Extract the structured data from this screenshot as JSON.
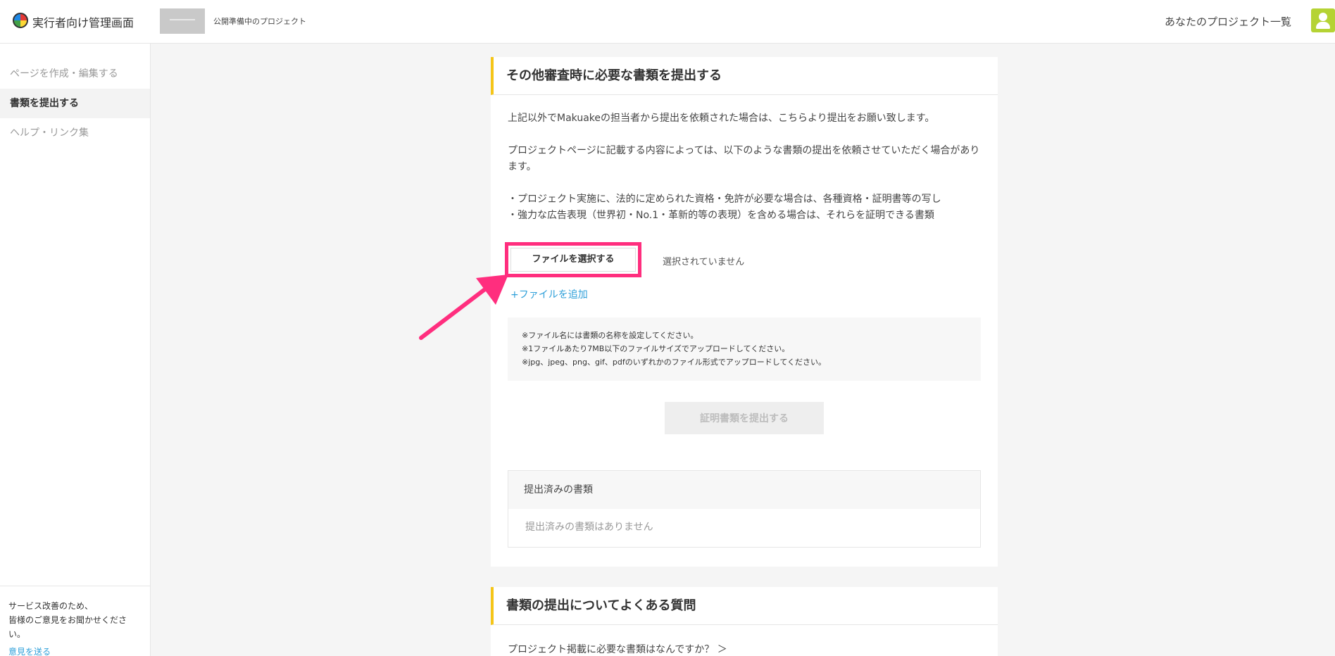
{
  "header": {
    "app_title": "実行者向け管理画面",
    "project_label": "公開準備中のプロジェクト",
    "your_projects": "あなたのプロジェクト一覧",
    "accent_color": "#b5d334"
  },
  "sidebar": {
    "items": [
      {
        "label": "ページを作成・編集する"
      },
      {
        "label": "書類を提出する"
      },
      {
        "label": "ヘルプ・リンク集"
      }
    ],
    "feedback_line1": "サービス改善のため、",
    "feedback_line2": "皆様のご意見をお聞かせください。",
    "feedback_link": "意見を送る"
  },
  "main": {
    "title": "その他審査時に必要な書類を提出する",
    "para1": "上記以外でMakuakeの担当者から提出を依頼された場合は、こちらより提出をお願い致します。",
    "para2": "プロジェクトページに記載する内容によっては、以下のような書類の提出を依頼させていただく場合があります。",
    "bullet1": "・プロジェクト実施に、法的に定められた資格・免許が必要な場合は、各種資格・証明書等の写し",
    "bullet2": "・強力な広告表現（世界初・No.1・革新的等の表現）を含める場合は、それらを証明できる書類",
    "choose_file": "ファイルを選択する",
    "no_file": "選択されていません",
    "add_file": "+ファイルを追加",
    "notes": [
      "※ファイル名には書類の名称を設定してください。",
      "※1ファイルあたり7MB以下のファイルサイズでアップロードしてください。",
      "※jpg、jpeg、png、gif、pdfのいずれかのファイル形式でアップロードしてください。"
    ],
    "submit": "証明書類を提出する",
    "submitted_header": "提出済みの書類",
    "submitted_empty": "提出済みの書類はありません",
    "highlight_color": "#ff2e7e"
  },
  "faq": {
    "title": "書類の提出についてよくある質問",
    "q1": "プロジェクト掲載に必要な書類はなんですか？ ＞"
  }
}
